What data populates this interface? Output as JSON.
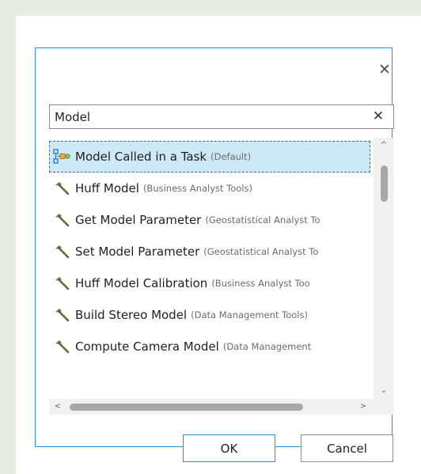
{
  "dialog": {
    "close_glyph": "✕",
    "search": {
      "value": "Model",
      "placeholder": "",
      "clear_glyph": "✕"
    },
    "results": [
      {
        "name": "Model Called in a Task",
        "category": "(Default)",
        "icon": "model-icon",
        "selected": true
      },
      {
        "name": "Huff Model",
        "category": "(Business Analyst Tools)",
        "icon": "hammer-icon",
        "selected": false
      },
      {
        "name": "Get Model Parameter",
        "category": "(Geostatistical Analyst To",
        "icon": "hammer-icon",
        "selected": false
      },
      {
        "name": "Set Model Parameter",
        "category": "(Geostatistical Analyst To",
        "icon": "hammer-icon",
        "selected": false
      },
      {
        "name": "Huff Model Calibration",
        "category": "(Business Analyst Too",
        "icon": "hammer-icon",
        "selected": false
      },
      {
        "name": "Build Stereo Model",
        "category": "(Data Management Tools)",
        "icon": "hammer-icon",
        "selected": false
      },
      {
        "name": "Compute Camera Model",
        "category": "(Data Management",
        "icon": "hammer-icon",
        "selected": false
      }
    ],
    "scrollbar": {
      "up": "^",
      "down": "⌄",
      "left": "<",
      "right": ">"
    },
    "buttons": {
      "ok": "OK",
      "cancel": "Cancel"
    }
  },
  "colors": {
    "accent": "#2f8fd0",
    "selection": "#cde8f7",
    "background": "#e8ebe3"
  }
}
